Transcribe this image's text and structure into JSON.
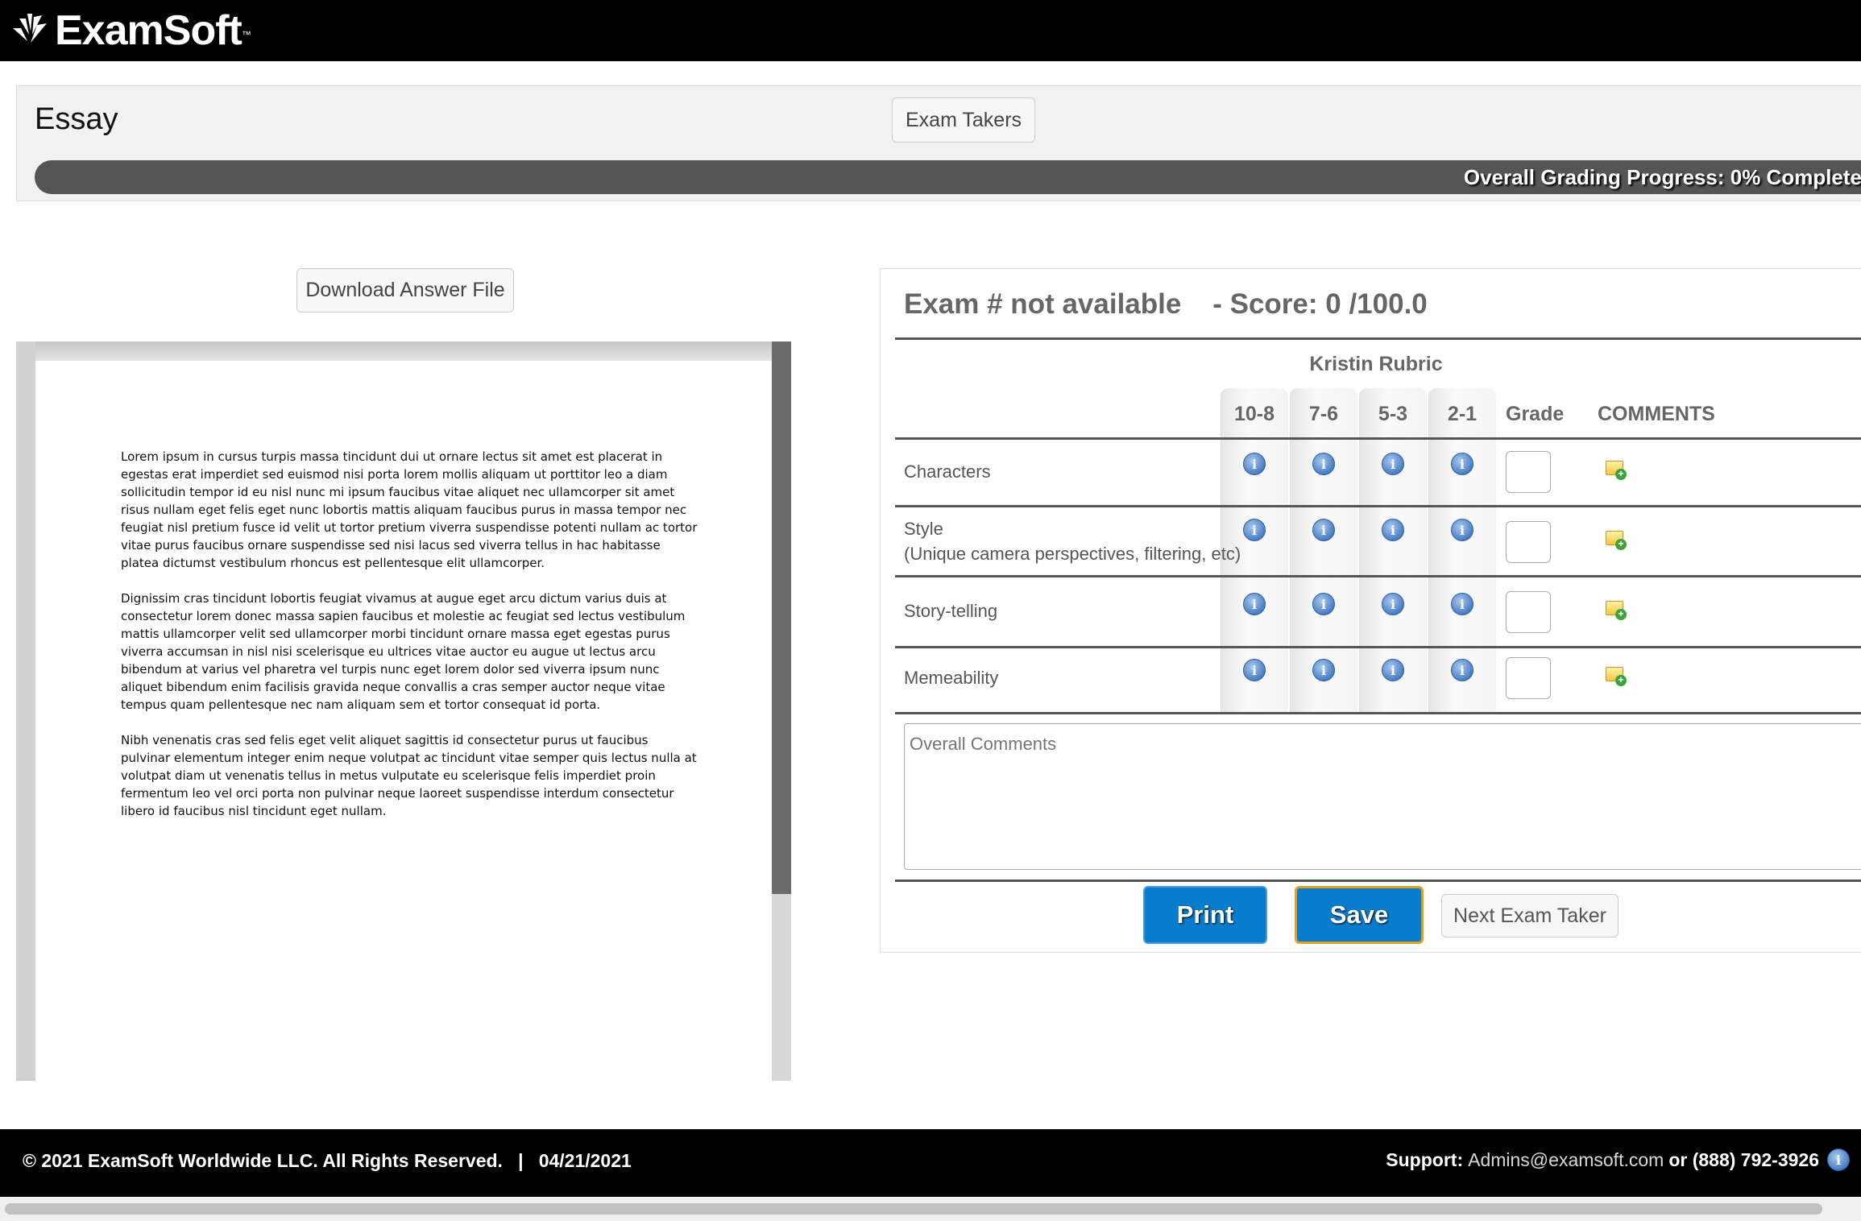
{
  "brand": {
    "name": "ExamSoft",
    "tm": "™"
  },
  "page": {
    "title": "Essay",
    "exam_takers_label": "Exam Takers"
  },
  "progress": {
    "text": "Overall Grading Progress: 0% Complete",
    "percent": 0
  },
  "viewer": {
    "download_label": "Download Answer File",
    "paragraphs": [
      "Lorem ipsum in cursus turpis massa tincidunt dui ut ornare lectus sit amet est placerat in egestas erat imperdiet sed euismod nisi porta lorem mollis aliquam ut porttitor leo a diam sollicitudin tempor id eu nisl nunc mi ipsum faucibus vitae aliquet nec ullamcorper sit amet risus nullam eget felis eget nunc lobortis mattis aliquam faucibus purus in massa tempor nec feugiat nisl pretium fusce id velit ut tortor pretium viverra suspendisse potenti nullam ac tortor vitae purus faucibus ornare suspendisse sed nisi lacus sed viverra tellus in hac habitasse platea dictumst vestibulum rhoncus est pellentesque elit ullamcorper.",
      "Dignissim cras tincidunt lobortis feugiat vivamus at augue eget arcu dictum varius duis at consectetur lorem donec massa sapien faucibus et molestie ac feugiat sed lectus vestibulum mattis ullamcorper velit sed ullamcorper morbi tincidunt ornare massa eget egestas purus viverra accumsan in nisl nisi scelerisque eu ultrices vitae auctor eu augue ut lectus arcu bibendum at varius vel pharetra vel turpis nunc eget lorem dolor sed viverra ipsum nunc aliquet bibendum enim facilisis gravida neque convallis a cras semper auctor neque vitae tempus quam pellentesque nec nam aliquam sem et tortor consequat id porta.",
      "Nibh venenatis cras sed felis eget velit aliquet sagittis id consectetur purus ut faucibus pulvinar elementum integer enim neque volutpat ac tincidunt vitae semper quis lectus nulla at volutpat diam ut venenatis tellus in metus vulputate eu scelerisque felis imperdiet proin fermentum leo vel orci porta non pulvinar neque laoreet suspendisse interdum consectetur libero id faucibus nisl tincidunt eget nullam."
    ]
  },
  "grading": {
    "header": "Exam # not available    - Score: 0 /100.0",
    "rubric_name": "Kristin Rubric",
    "score_columns": [
      "10-8",
      "7-6",
      "5-3",
      "2-1"
    ],
    "grade_label": "Grade",
    "comments_label": "COMMENTS",
    "rows": [
      {
        "line1": "Characters",
        "line2": ""
      },
      {
        "line1": "Style",
        "line2": "(Unique camera perspectives, filtering, etc)"
      },
      {
        "line1": "Story-telling",
        "line2": ""
      },
      {
        "line1": "Memeability",
        "line2": ""
      }
    ],
    "overall_comments_placeholder": "Overall Comments",
    "print_label": "Print",
    "save_label": "Save",
    "next_label": "Next Exam Taker"
  },
  "footer": {
    "copyright": "© 2021 ExamSoft Worldwide LLC. All Rights Reserved.   |   04/21/2021",
    "support_label": "Support:",
    "support_email": "Admins@examsoft.com",
    "support_phone": "or (888) 792-3926"
  },
  "colors": {
    "accent": "#0a7ccc",
    "save_outline": "#e0a020",
    "progress_bg": "#555555"
  }
}
